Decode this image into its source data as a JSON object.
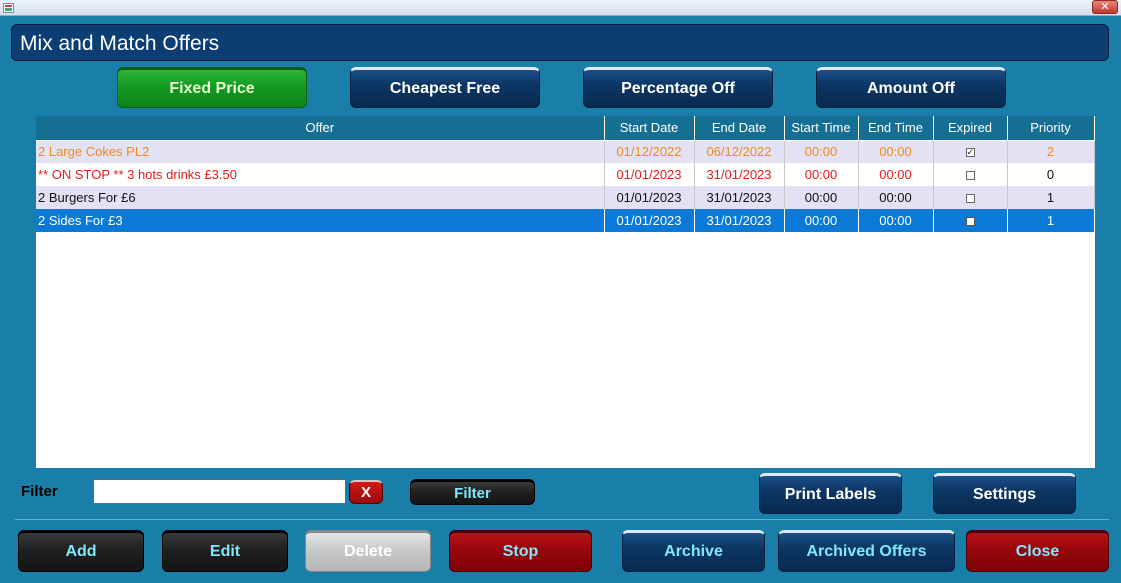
{
  "window": {
    "close_glyph": "✕"
  },
  "header": {
    "title": "Mix and Match Offers"
  },
  "tabs": [
    {
      "label": "Fixed Price",
      "active": true
    },
    {
      "label": "Cheapest Free",
      "active": false
    },
    {
      "label": "Percentage Off",
      "active": false
    },
    {
      "label": "Amount Off",
      "active": false
    }
  ],
  "table": {
    "columns": [
      "Offer",
      "Start Date",
      "End Date",
      "Start Time",
      "End Time",
      "Expired",
      "Priority"
    ],
    "rows": [
      {
        "offer": "2 Large Cokes PL2",
        "start_date": "01/12/2022",
        "end_date": "06/12/2022",
        "start_time": "00:00",
        "end_time": "00:00",
        "expired": true,
        "priority": "2"
      },
      {
        "offer": "** ON STOP ** 3 hots drinks £3.50",
        "start_date": "01/01/2023",
        "end_date": "31/01/2023",
        "start_time": "00:00",
        "end_time": "00:00",
        "expired": false,
        "priority": "0"
      },
      {
        "offer": "2 Burgers For £6",
        "start_date": "01/01/2023",
        "end_date": "31/01/2023",
        "start_time": "00:00",
        "end_time": "00:00",
        "expired": false,
        "priority": "1"
      },
      {
        "offer": "2 Sides For £3",
        "start_date": "01/01/2023",
        "end_date": "31/01/2023",
        "start_time": "00:00",
        "end_time": "00:00",
        "expired": false,
        "priority": "1"
      }
    ]
  },
  "filter": {
    "label": "Filter",
    "value": "",
    "clear_label": "X",
    "button_label": "Filter"
  },
  "side_actions": {
    "print_labels": "Print Labels",
    "settings": "Settings"
  },
  "actions": {
    "add": "Add",
    "edit": "Edit",
    "delete": "Delete",
    "stop": "Stop",
    "archive": "Archive",
    "archived_offers": "Archived Offers",
    "close": "Close"
  },
  "colors": {
    "background": "#1a7fa8",
    "header": "#0c3d73",
    "selected_row": "#0a79d8",
    "expired_text": "#f28a1a",
    "stopped_text": "#e81b1b"
  }
}
